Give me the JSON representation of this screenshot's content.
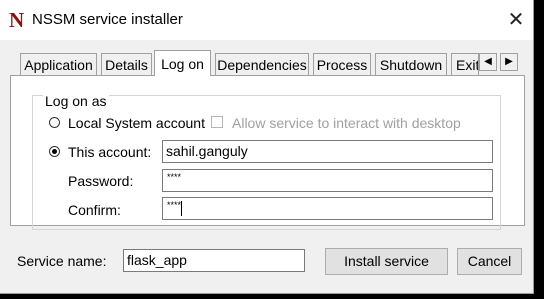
{
  "window": {
    "title": "NSSM service installer",
    "icon": "N"
  },
  "tabs": [
    {
      "label": "Application",
      "active": false
    },
    {
      "label": "Details",
      "active": false
    },
    {
      "label": "Log on",
      "active": true
    },
    {
      "label": "Dependencies",
      "active": false
    },
    {
      "label": "Process",
      "active": false
    },
    {
      "label": "Shutdown",
      "active": false
    },
    {
      "label": "Exit",
      "active": false
    }
  ],
  "logon": {
    "group_label": "Log on as",
    "local_system_label": "Local System account",
    "allow_desktop_label": "Allow service to interact with desktop",
    "this_account_label": "This account:",
    "account_value": "sahil.ganguly",
    "password_label": "Password:",
    "password_mask": "****",
    "confirm_label": "Confirm:",
    "confirm_mask": "****",
    "selected_option": "this_account",
    "allow_desktop_checked": false
  },
  "footer": {
    "service_name_label": "Service name:",
    "service_name_value": "flask_app",
    "install_label": "Install service",
    "cancel_label": "Cancel"
  },
  "icons": {
    "close": "close-icon",
    "tab_left": "arrow-left-icon",
    "tab_right": "arrow-right-icon"
  }
}
